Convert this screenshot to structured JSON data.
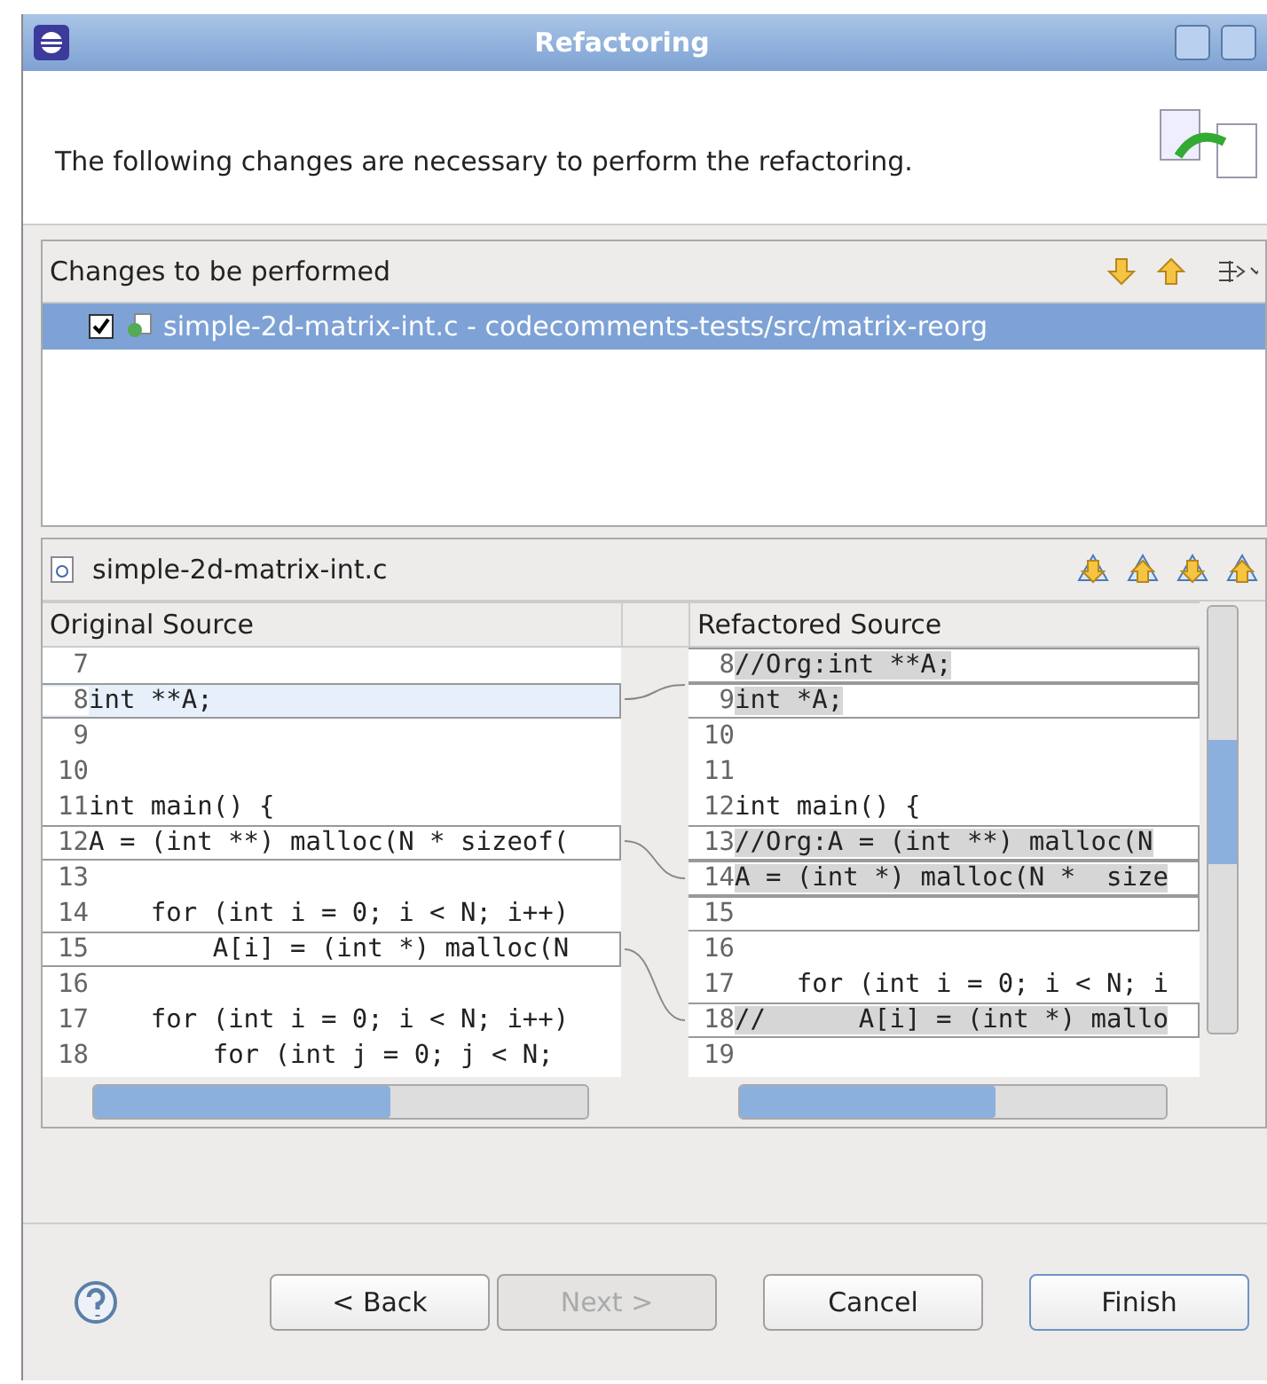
{
  "window": {
    "title": "Refactoring"
  },
  "header": {
    "message": "The following changes are necessary to perform the refactoring."
  },
  "changes": {
    "title": "Changes to be performed",
    "items": [
      {
        "label": "simple-2d-matrix-int.c - codecomments-tests/src/matrix-reorg",
        "checked": true,
        "selected": true
      }
    ]
  },
  "compare": {
    "file": "simple-2d-matrix-int.c",
    "original": {
      "title": "Original Source",
      "lines": [
        {
          "num": "7",
          "boxed": false,
          "selected": false
        },
        {
          "num": "8",
          "text": "int **A;",
          "boxed": true,
          "selected": true
        },
        {
          "num": "9",
          "boxed": false,
          "selected": false
        },
        {
          "num": "10",
          "boxed": false,
          "selected": false
        },
        {
          "num": "11",
          "text": "int main() {",
          "boxed": false,
          "selected": false
        },
        {
          "num": "12",
          "text": "A = (int **) malloc(N * sizeof(",
          "boxed": true,
          "selected": false
        },
        {
          "num": "13",
          "boxed": false,
          "selected": false
        },
        {
          "num": "14",
          "text": "    for (int i = 0; i < N; i++)",
          "boxed": false,
          "selected": false
        },
        {
          "num": "15",
          "text": "        A[i] = (int *) malloc(N",
          "boxed": true,
          "selected": false
        },
        {
          "num": "16",
          "boxed": false,
          "selected": false
        },
        {
          "num": "17",
          "text": "    for (int i = 0; i < N; i++)",
          "boxed": false,
          "selected": false
        },
        {
          "num": "18",
          "text": "        for (int j = 0; j < N;",
          "boxed": false,
          "selected": false
        }
      ]
    },
    "refactored": {
      "title": "Refactored Source",
      "lines": [
        {
          "num": "8",
          "text": "//Org:int **A;",
          "boxed": true,
          "changed": true
        },
        {
          "num": "9",
          "text": "int *A;",
          "boxed": true,
          "changed": true
        },
        {
          "num": "10",
          "boxed": false,
          "changed": false
        },
        {
          "num": "11",
          "boxed": false,
          "changed": false
        },
        {
          "num": "12",
          "text": "int main() {",
          "boxed": false,
          "changed": false
        },
        {
          "num": "13",
          "text": "//Org:A = (int **) malloc(N",
          "boxed": true,
          "changed": true
        },
        {
          "num": "14",
          "text": "A = (int *) malloc(N *  size",
          "boxed": true,
          "changed": true
        },
        {
          "num": "15",
          "boxed": true,
          "changed": false
        },
        {
          "num": "16",
          "boxed": false,
          "changed": false
        },
        {
          "num": "17",
          "text": "    for (int i = 0; i < N; i",
          "boxed": false,
          "changed": false
        },
        {
          "num": "18",
          "text": "//      A[i] = (int *) mallo",
          "boxed": true,
          "changed": true
        },
        {
          "num": "19",
          "boxed": false,
          "changed": false
        }
      ]
    }
  },
  "buttons": [
    {
      "label": "< Back",
      "kind": "normal",
      "disabled": false
    },
    {
      "label": "Next >",
      "kind": "normal",
      "disabled": true
    },
    {
      "label": "Cancel",
      "kind": "normal",
      "disabled": false
    },
    {
      "label": "Finish",
      "kind": "default",
      "disabled": false
    }
  ]
}
